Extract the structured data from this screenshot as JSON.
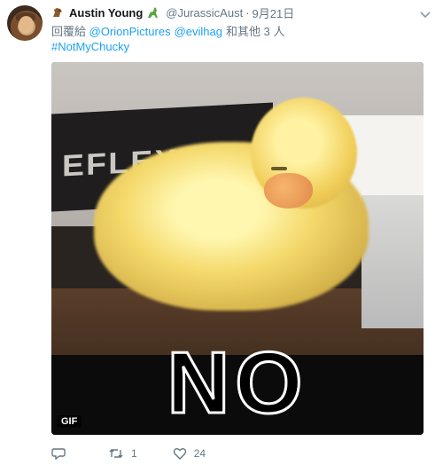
{
  "tweet": {
    "author_name": "Austin Young",
    "author_handle": "@JurassicAust",
    "separator": "·",
    "date": "9月21日",
    "reply_prefix": "回覆給",
    "mentions": [
      "@OrionPictures",
      "@evilhag"
    ],
    "reply_suffix": "和其他 3 人",
    "hashtag": "#NotMyChucky",
    "media": {
      "caption_text": "NO",
      "book_text": "EFLEX",
      "gif_label": "GIF"
    },
    "actions": {
      "reply": {
        "icon": "reply-icon",
        "count": ""
      },
      "retweet": {
        "icon": "retweet-icon",
        "count": "1"
      },
      "like": {
        "icon": "heart-icon",
        "count": "24"
      }
    }
  },
  "colors": {
    "link": "#1da1f2",
    "meta": "#657786",
    "text": "#14171a"
  }
}
